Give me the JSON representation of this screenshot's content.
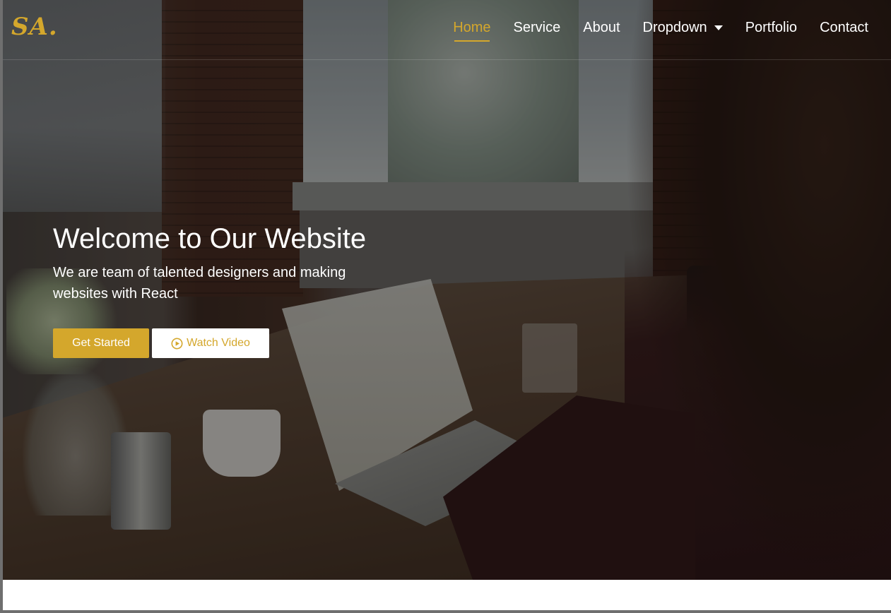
{
  "logo": {
    "text": "SA."
  },
  "nav": {
    "items": [
      {
        "label": "Home"
      },
      {
        "label": "Service"
      },
      {
        "label": "About"
      },
      {
        "label": "Dropdown"
      },
      {
        "label": "Portfolio"
      },
      {
        "label": "Contact"
      }
    ],
    "active_index": 0
  },
  "hero": {
    "title": "Welcome to Our Website",
    "subtitle": "We are team of talented designers and making websites with React",
    "primary_button": "Get Started",
    "secondary_button": "Watch Video",
    "secondary_icon": "play-circle-icon"
  },
  "colors": {
    "accent": "#d4a72c",
    "text": "#ffffff"
  }
}
